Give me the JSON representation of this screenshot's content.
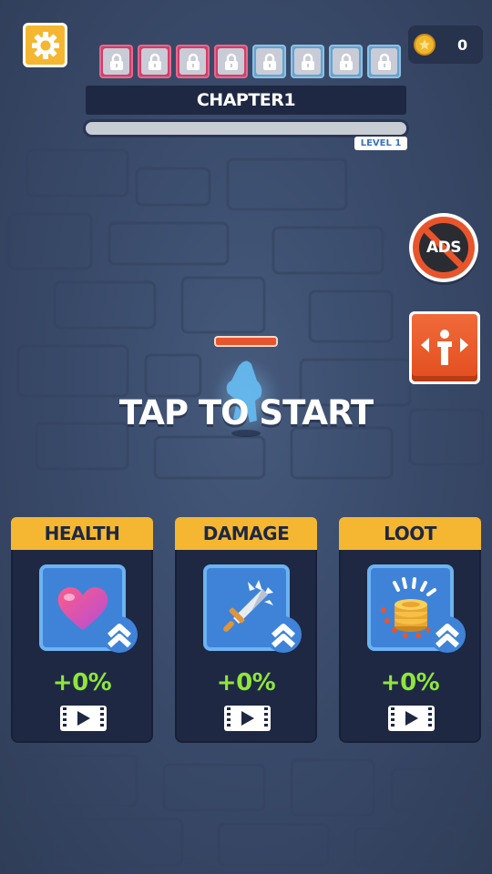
{
  "hud": {
    "chapter_label": "CHAPTER1",
    "level_label": "LEVEL 1",
    "coins": "0",
    "progress_fraction": 0,
    "stage_locks": [
      {
        "color": "pink"
      },
      {
        "color": "pink"
      },
      {
        "color": "pink"
      },
      {
        "color": "pink"
      },
      {
        "color": "blue"
      },
      {
        "color": "blue"
      },
      {
        "color": "blue"
      },
      {
        "color": "blue"
      }
    ]
  },
  "buttons": {
    "settings_icon": "gear-icon",
    "no_ads_label": "ADS",
    "move_icon": "move-arrows-icon"
  },
  "center": {
    "prompt": "TAP TO START"
  },
  "upgrades": [
    {
      "title": "HEALTH",
      "value": "+0%",
      "icon": "heart-icon"
    },
    {
      "title": "DAMAGE",
      "value": "+0%",
      "icon": "sword-icon"
    },
    {
      "title": "LOOT",
      "value": "+0%",
      "icon": "coin-stack-icon"
    }
  ],
  "colors": {
    "accent_yellow": "#f5b731",
    "accent_orange": "#e8552c",
    "percent_green": "#8ee63c",
    "panel_navy": "#1e2843"
  }
}
